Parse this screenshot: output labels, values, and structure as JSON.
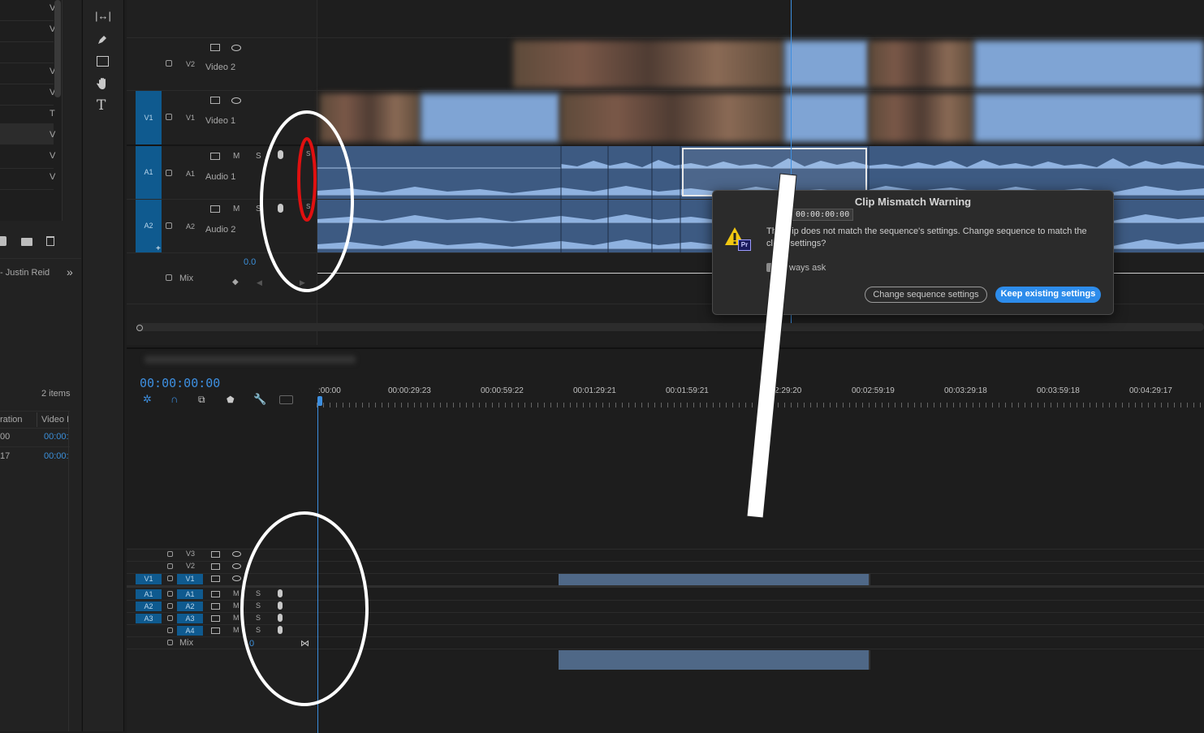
{
  "project_panel": {
    "item_count": "2 items",
    "owner_text": "- Justin Reid",
    "columns": [
      "ration",
      "Video I"
    ],
    "rows": [
      {
        "c1": "00",
        "c2": "00:00:"
      },
      {
        "c1": "17",
        "c2": "00:00:"
      }
    ],
    "top_marks": [
      "V",
      "V",
      "V",
      "V",
      "T",
      "V",
      "V",
      "V"
    ]
  },
  "tools": [
    "ripple-edit",
    "pen",
    "rectangle",
    "hand",
    "type"
  ],
  "source_tracks": [
    {
      "label": "V2",
      "name": "Video 2"
    },
    {
      "label": "V1",
      "name": "Video 1",
      "target": "V1"
    },
    {
      "label": "A1",
      "name": "Audio 1",
      "target": "A1"
    },
    {
      "label": "A2",
      "name": "Audio 2",
      "target": "A2"
    }
  ],
  "mix": {
    "label": "Mix",
    "value": "0.0"
  },
  "track_letters": {
    "mute": "M",
    "solo": "S"
  },
  "dialog": {
    "title": "Clip Mismatch Warning",
    "timecode": "00:00:00:00",
    "line1": "Th      ip does not match the sequence's settings. Change sequence to match the",
    "line2": "cl       settings?",
    "checkbox_label": "ways ask",
    "btn_change": "Change sequence settings",
    "btn_keep": "Keep existing settings",
    "app_badge": "Pr"
  },
  "sequence": {
    "timecode": "00:00:00:00",
    "ruler": ":00:00",
    "ticks": [
      "00:00:29:23",
      "00:00:59:22",
      "00:01:29:21",
      "00:01:59:21",
      "2:29:20",
      "00:02:59:19",
      "00:03:29:18",
      "00:03:59:18",
      "00:04:29:17"
    ],
    "video_tracks": [
      "V3",
      "V2",
      "V1"
    ],
    "audio_tracks": [
      "A1",
      "A2",
      "A3",
      "A4"
    ],
    "source_targets_v": [
      "V1"
    ],
    "source_targets_a": [
      "A1",
      "A2",
      "A3"
    ],
    "mix_label": "Mix",
    "mix_value": ".0"
  },
  "colors": {
    "accent_blue": "#2d8ceb",
    "track_target": "#0f5a8f",
    "annotation_red": "#e01010",
    "annotation_white": "#ffffff"
  }
}
